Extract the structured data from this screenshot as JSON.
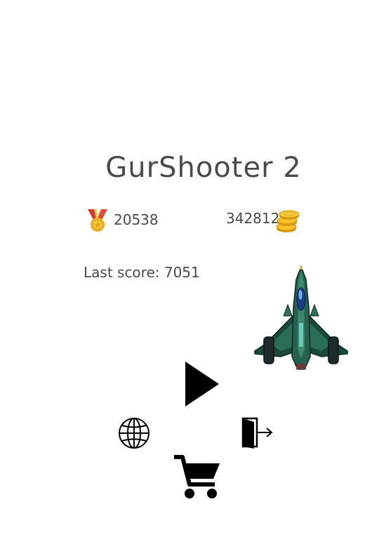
{
  "game": {
    "title": "GurShooter 2"
  },
  "stats": {
    "best_score": "20538",
    "best_icon": "medal-icon",
    "coins": "342812",
    "coins_icon": "coin-stack-icon"
  },
  "last_score": {
    "label": "Last score:",
    "value": "7051"
  },
  "buttons": {
    "play_icon": "play-icon",
    "language_icon": "globe-icon",
    "exit_icon": "exit-door-icon",
    "shop_icon": "shopping-cart-icon"
  },
  "colors": {
    "text": "#4a4a4a",
    "medal_ribbon": "#d93a2b",
    "medal_gold": "#f2b21a",
    "coin_gold": "#f5c02a",
    "ship_hull": "#1f5a48",
    "icon": "#000000"
  }
}
